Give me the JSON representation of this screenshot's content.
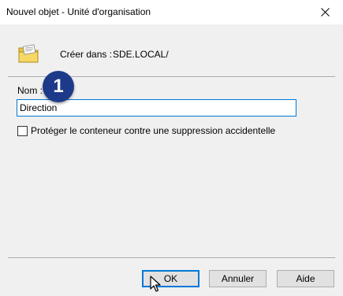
{
  "window": {
    "title": "Nouvel objet - Unité d'organisation"
  },
  "icons": {
    "close": "close-icon",
    "folder": "ou-folder-icon",
    "pointer": "mouse-pointer-icon"
  },
  "create_in": {
    "label": "Créer dans :",
    "value": "SDE.LOCAL/"
  },
  "name": {
    "label": "Nom :",
    "value": "Direction"
  },
  "badge": {
    "text": "1"
  },
  "protect": {
    "label": "Protéger le conteneur contre une suppression accidentelle",
    "checked": false
  },
  "buttons": {
    "ok": "OK",
    "cancel": "Annuler",
    "help": "Aide"
  },
  "colors": {
    "focus_accent": "#0078d7",
    "badge": "#1d3a8a"
  }
}
